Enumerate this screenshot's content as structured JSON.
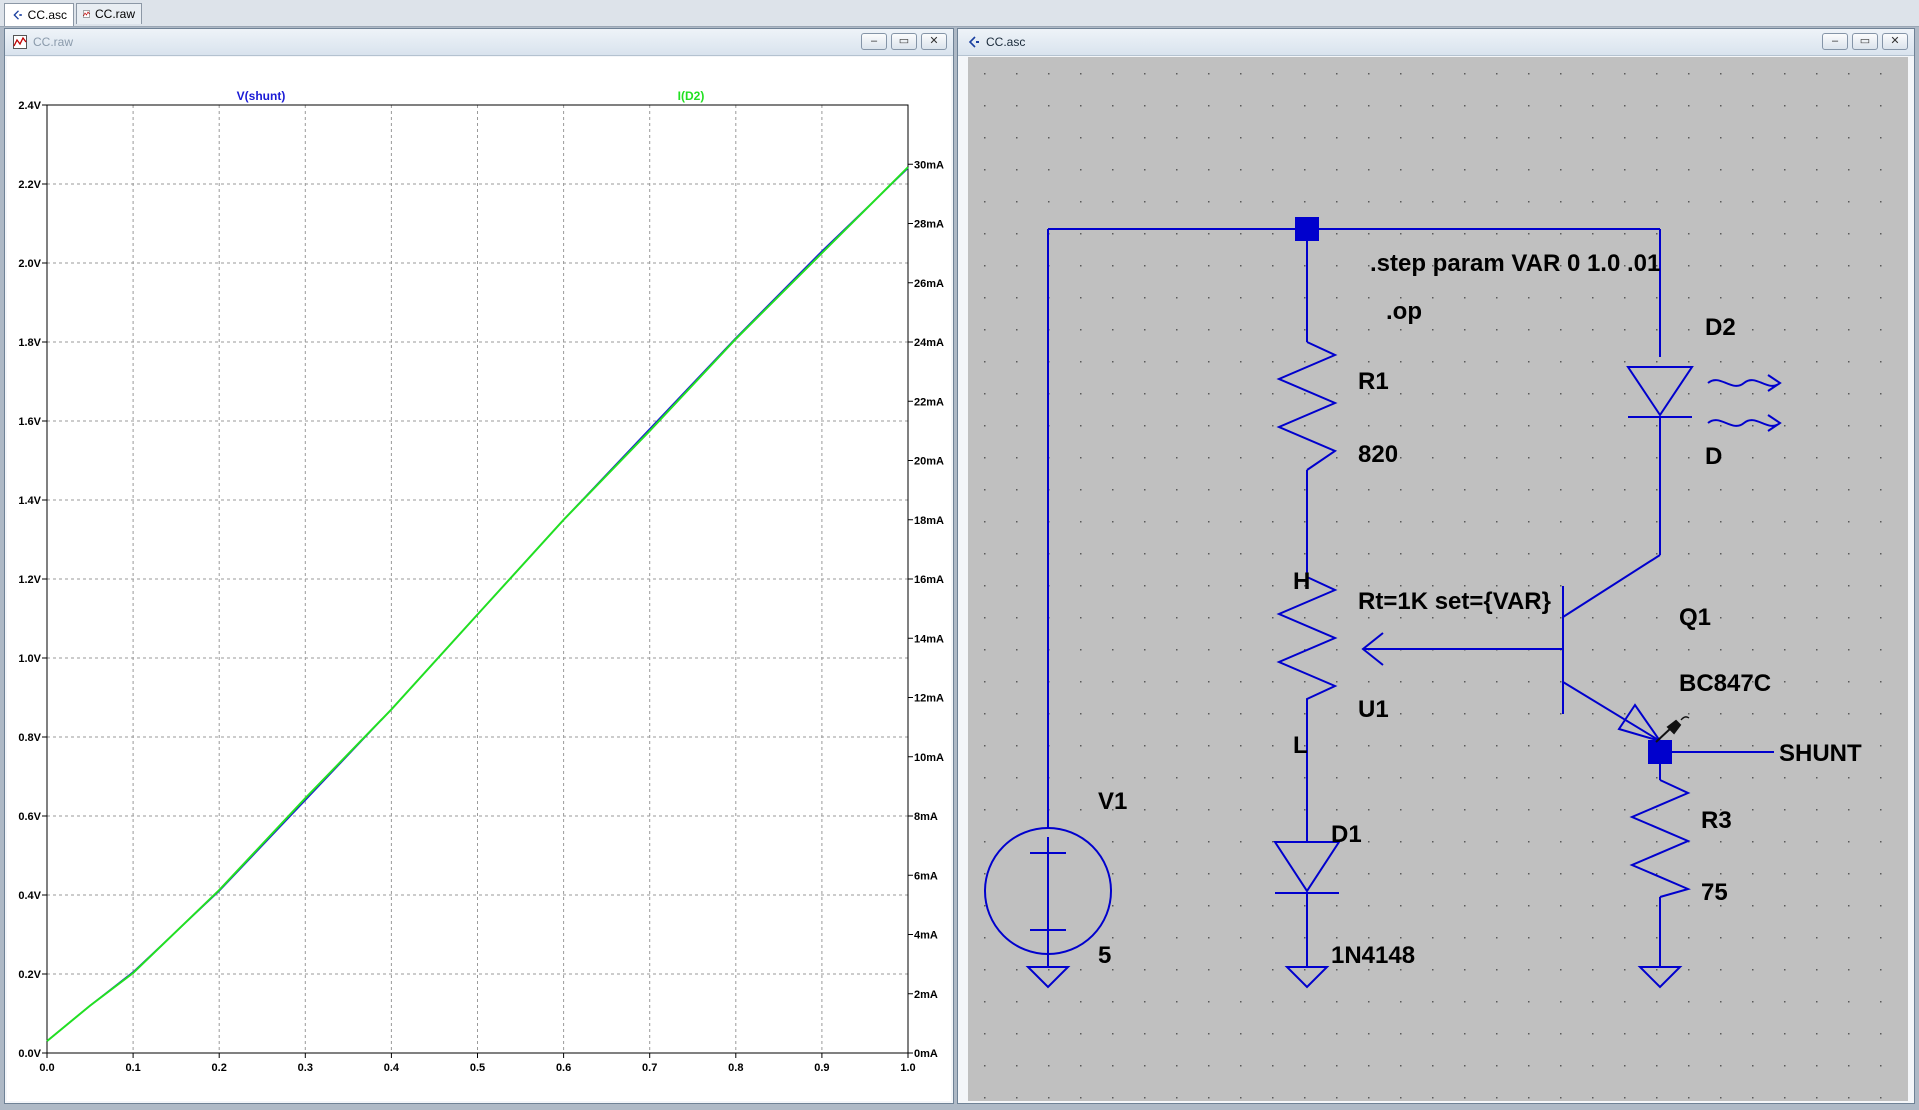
{
  "tabs": [
    {
      "label": "CC.asc",
      "icon": "schematic-icon",
      "active": true
    },
    {
      "label": "CC.raw",
      "icon": "waveform-icon",
      "active": false
    }
  ],
  "plot_window": {
    "title": "CC.raw",
    "traces": [
      {
        "name": "V(shunt)",
        "color": "#1a1ad6"
      },
      {
        "name": "I(D2)",
        "color": "#22e022"
      }
    ]
  },
  "schematic_window": {
    "title": "CC.asc",
    "directives": [
      ".step param VAR 0 1.0 .01",
      ".op"
    ],
    "components": {
      "r1_name": "R1",
      "r1_value": "820",
      "u1_name": "U1",
      "u1_value": "Rt=1K set={VAR}",
      "u1_h": "H",
      "u1_l": "L",
      "d1_name": "D1",
      "d1_value": "1N4148",
      "d2_name": "D2",
      "d2_value": "D",
      "q1_name": "Q1",
      "q1_value": "BC847C",
      "r3_name": "R3",
      "r3_value": "75",
      "v1_name": "V1",
      "v1_value": "5",
      "net_label": "SHUNT"
    },
    "colors": {
      "wire": "#0000cd",
      "background": "#c0c0c0",
      "grid_dots": "#5a5a5a"
    }
  },
  "window_buttons": {
    "minimize": "–",
    "restore": "▭",
    "close": "✕"
  },
  "chart_data": {
    "type": "line",
    "x": [
      0.0,
      0.05,
      0.1,
      0.2,
      0.3,
      0.4,
      0.5,
      0.6,
      0.7,
      0.8,
      0.9,
      1.0
    ],
    "series": [
      {
        "name": "V(shunt)",
        "axis": "left",
        "values": [
          0.03,
          0.12,
          0.205,
          0.41,
          0.64,
          0.87,
          1.11,
          1.35,
          1.58,
          1.81,
          2.03,
          2.24
        ]
      },
      {
        "name": "I(D2)",
        "axis": "right",
        "values": [
          0.4,
          1.6,
          2.7,
          5.5,
          8.6,
          11.6,
          14.8,
          18.0,
          21.0,
          24.1,
          27.0,
          29.9
        ]
      }
    ],
    "xlim": [
      0.0,
      1.0
    ],
    "ylim_left": [
      0.0,
      2.4
    ],
    "ylim_right": [
      0,
      32
    ],
    "x_ticks": [
      "0.0",
      "0.1",
      "0.2",
      "0.3",
      "0.4",
      "0.5",
      "0.6",
      "0.7",
      "0.8",
      "0.9",
      "1.0"
    ],
    "y_left_ticks": [
      {
        "value": 0.0,
        "label": "0.0V"
      },
      {
        "value": 0.2,
        "label": "0.2V"
      },
      {
        "value": 0.4,
        "label": "0.4V"
      },
      {
        "value": 0.6,
        "label": "0.6V"
      },
      {
        "value": 0.8,
        "label": "0.8V"
      },
      {
        "value": 1.0,
        "label": "1.0V"
      },
      {
        "value": 1.2,
        "label": "1.2V"
      },
      {
        "value": 1.4,
        "label": "1.4V"
      },
      {
        "value": 1.6,
        "label": "1.6V"
      },
      {
        "value": 1.8,
        "label": "1.8V"
      },
      {
        "value": 2.0,
        "label": "2.0V"
      },
      {
        "value": 2.2,
        "label": "2.2V"
      },
      {
        "value": 2.4,
        "label": "2.4V"
      }
    ],
    "y_right_ticks": [
      {
        "value": 0,
        "label": "0mA"
      },
      {
        "value": 2,
        "label": "2mA"
      },
      {
        "value": 4,
        "label": "4mA"
      },
      {
        "value": 6,
        "label": "6mA"
      },
      {
        "value": 8,
        "label": "8mA"
      },
      {
        "value": 10,
        "label": "10mA"
      },
      {
        "value": 12,
        "label": "12mA"
      },
      {
        "value": 14,
        "label": "14mA"
      },
      {
        "value": 16,
        "label": "16mA"
      },
      {
        "value": 18,
        "label": "18mA"
      },
      {
        "value": 20,
        "label": "20mA"
      },
      {
        "value": 22,
        "label": "22mA"
      },
      {
        "value": 24,
        "label": "24mA"
      },
      {
        "value": 26,
        "label": "26mA"
      },
      {
        "value": 28,
        "label": "28mA"
      },
      {
        "value": 30,
        "label": "30mA"
      }
    ],
    "grid": true
  }
}
